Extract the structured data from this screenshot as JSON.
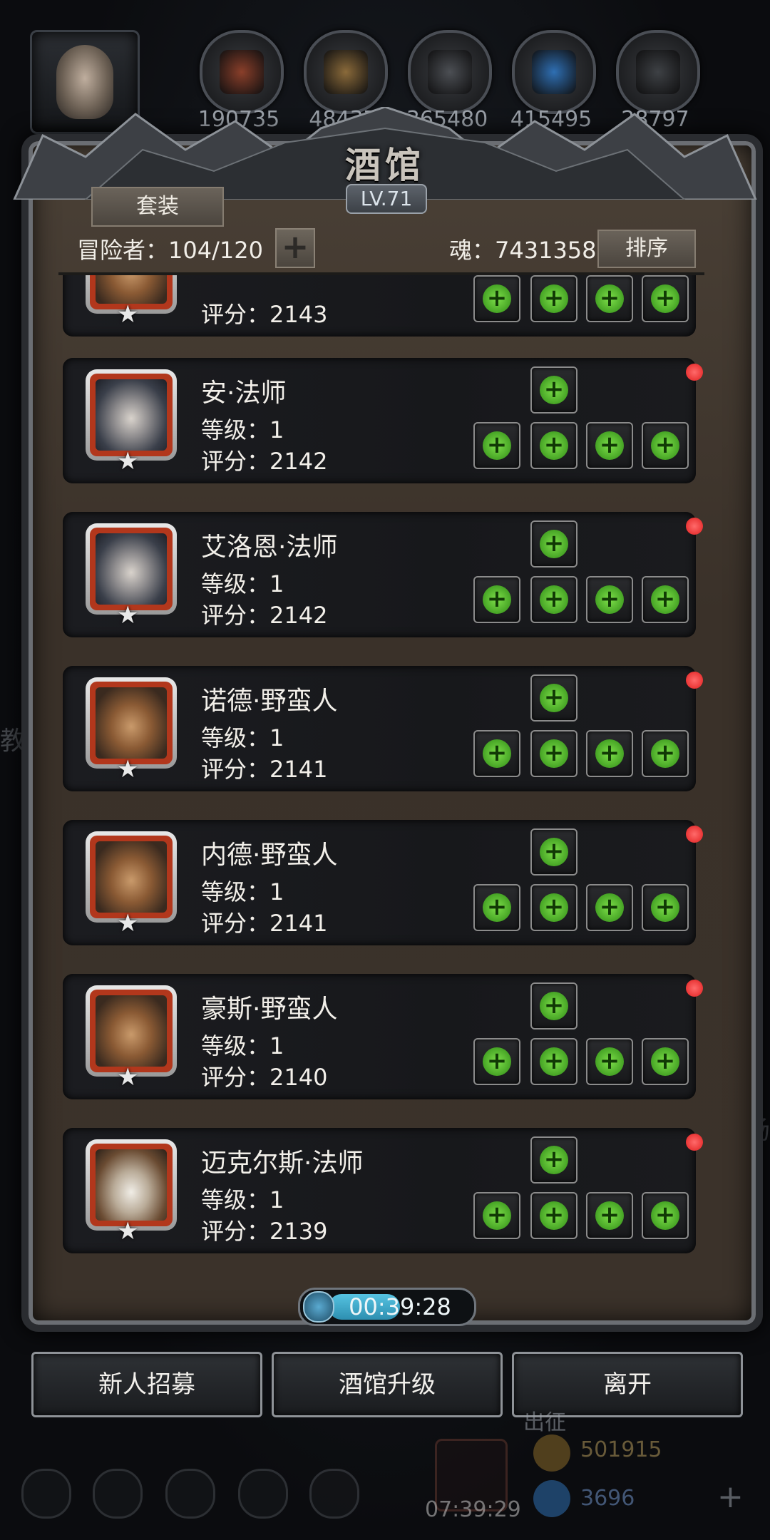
{
  "resources": [
    {
      "name": "meat",
      "value": "190735",
      "color": "#8a3f2a"
    },
    {
      "name": "wood",
      "value": "48437",
      "color": "#8a6a3a"
    },
    {
      "name": "iron",
      "value": "365480",
      "color": "#4c4f54"
    },
    {
      "name": "crystal",
      "value": "415495",
      "color": "#2f6fb3"
    },
    {
      "name": "stone",
      "value": "28797",
      "color": "#3e4145"
    }
  ],
  "tavern": {
    "title": "酒馆",
    "level": "LV.71",
    "set_button": "套装",
    "adventurers_label": "冒险者：104/120",
    "soul_label": "魂：7431358",
    "sort_button": "排序"
  },
  "heroes": [
    {
      "name": "",
      "level": "",
      "score": "评分：2143",
      "portrait": "barb",
      "new": false,
      "top_slot": false
    },
    {
      "name": "安·法师",
      "level": "等级：1",
      "score": "评分：2142",
      "portrait": "mage",
      "new": true,
      "top_slot": true
    },
    {
      "name": "艾洛恩·法师",
      "level": "等级：1",
      "score": "评分：2142",
      "portrait": "mage",
      "new": true,
      "top_slot": true
    },
    {
      "name": "诺德·野蛮人",
      "level": "等级：1",
      "score": "评分：2141",
      "portrait": "barb",
      "new": true,
      "top_slot": true
    },
    {
      "name": "内德·野蛮人",
      "level": "等级：1",
      "score": "评分：2141",
      "portrait": "barb",
      "new": true,
      "top_slot": true
    },
    {
      "name": "豪斯·野蛮人",
      "level": "等级：1",
      "score": "评分：2140",
      "portrait": "barb",
      "new": true,
      "top_slot": true
    },
    {
      "name": "迈克尔斯·法师",
      "level": "等级：1",
      "score": "评分：2139",
      "portrait": "elder",
      "new": true,
      "top_slot": true
    }
  ],
  "timer": {
    "value": "00:39:28",
    "progress": 0.5
  },
  "buttons": {
    "recruit": "新人招募",
    "upgrade": "酒馆升级",
    "leave": "离开"
  },
  "hud": {
    "gold": "501915",
    "gems": "3696",
    "gift_timer": "07:39:29",
    "expedition": "出征",
    "left_text": "教",
    "right_text": "场"
  },
  "colors": {
    "accent_green": "#5fd12d",
    "new_dot": "#e01f1f"
  }
}
